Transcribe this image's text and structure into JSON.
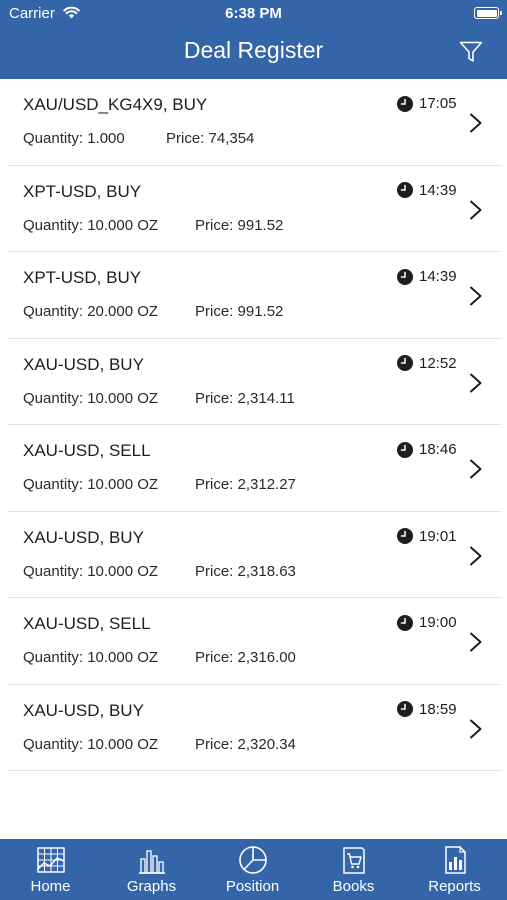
{
  "status_bar": {
    "carrier": "Carrier",
    "time": "6:38 PM"
  },
  "header": {
    "title": "Deal Register"
  },
  "deals": [
    {
      "symbol": "XAU/USD_KG4X9,  BUY",
      "time": "17:05",
      "quantity": "Quantity:  1.000",
      "price": "Price:  74,354"
    },
    {
      "symbol": "XPT-USD,  BUY",
      "time": "14:39",
      "quantity": "Quantity:  10.000 OZ",
      "price": "Price:  991.52"
    },
    {
      "symbol": "XPT-USD,  BUY",
      "time": "14:39",
      "quantity": "Quantity:  20.000 OZ",
      "price": "Price:  991.52"
    },
    {
      "symbol": "XAU-USD,  BUY",
      "time": "12:52",
      "quantity": "Quantity:  10.000 OZ",
      "price": "Price:  2,314.11"
    },
    {
      "symbol": "XAU-USD,  SELL",
      "time": "18:46",
      "quantity": "Quantity:  10.000 OZ",
      "price": "Price:  2,312.27"
    },
    {
      "symbol": "XAU-USD,  BUY",
      "time": "19:01",
      "quantity": "Quantity:  10.000 OZ",
      "price": "Price:  2,318.63"
    },
    {
      "symbol": "XAU-USD,  SELL",
      "time": "19:00",
      "quantity": "Quantity:  10.000 OZ",
      "price": "Price:  2,316.00"
    },
    {
      "symbol": "XAU-USD,  BUY",
      "time": "18:59",
      "quantity": "Quantity:  10.000 OZ",
      "price": "Price:  2,320.34"
    }
  ],
  "tabbar": {
    "items": [
      {
        "label": "Home",
        "icon": "grid-icon"
      },
      {
        "label": "Graphs",
        "icon": "bar-chart-icon"
      },
      {
        "label": "Position",
        "icon": "pie-chart-icon"
      },
      {
        "label": "Books",
        "icon": "book-cart-icon"
      },
      {
        "label": "Reports",
        "icon": "report-icon"
      }
    ]
  },
  "colors": {
    "brand": "#3565a9",
    "text": "#1e1e1e",
    "divider": "#e4e4e4"
  }
}
